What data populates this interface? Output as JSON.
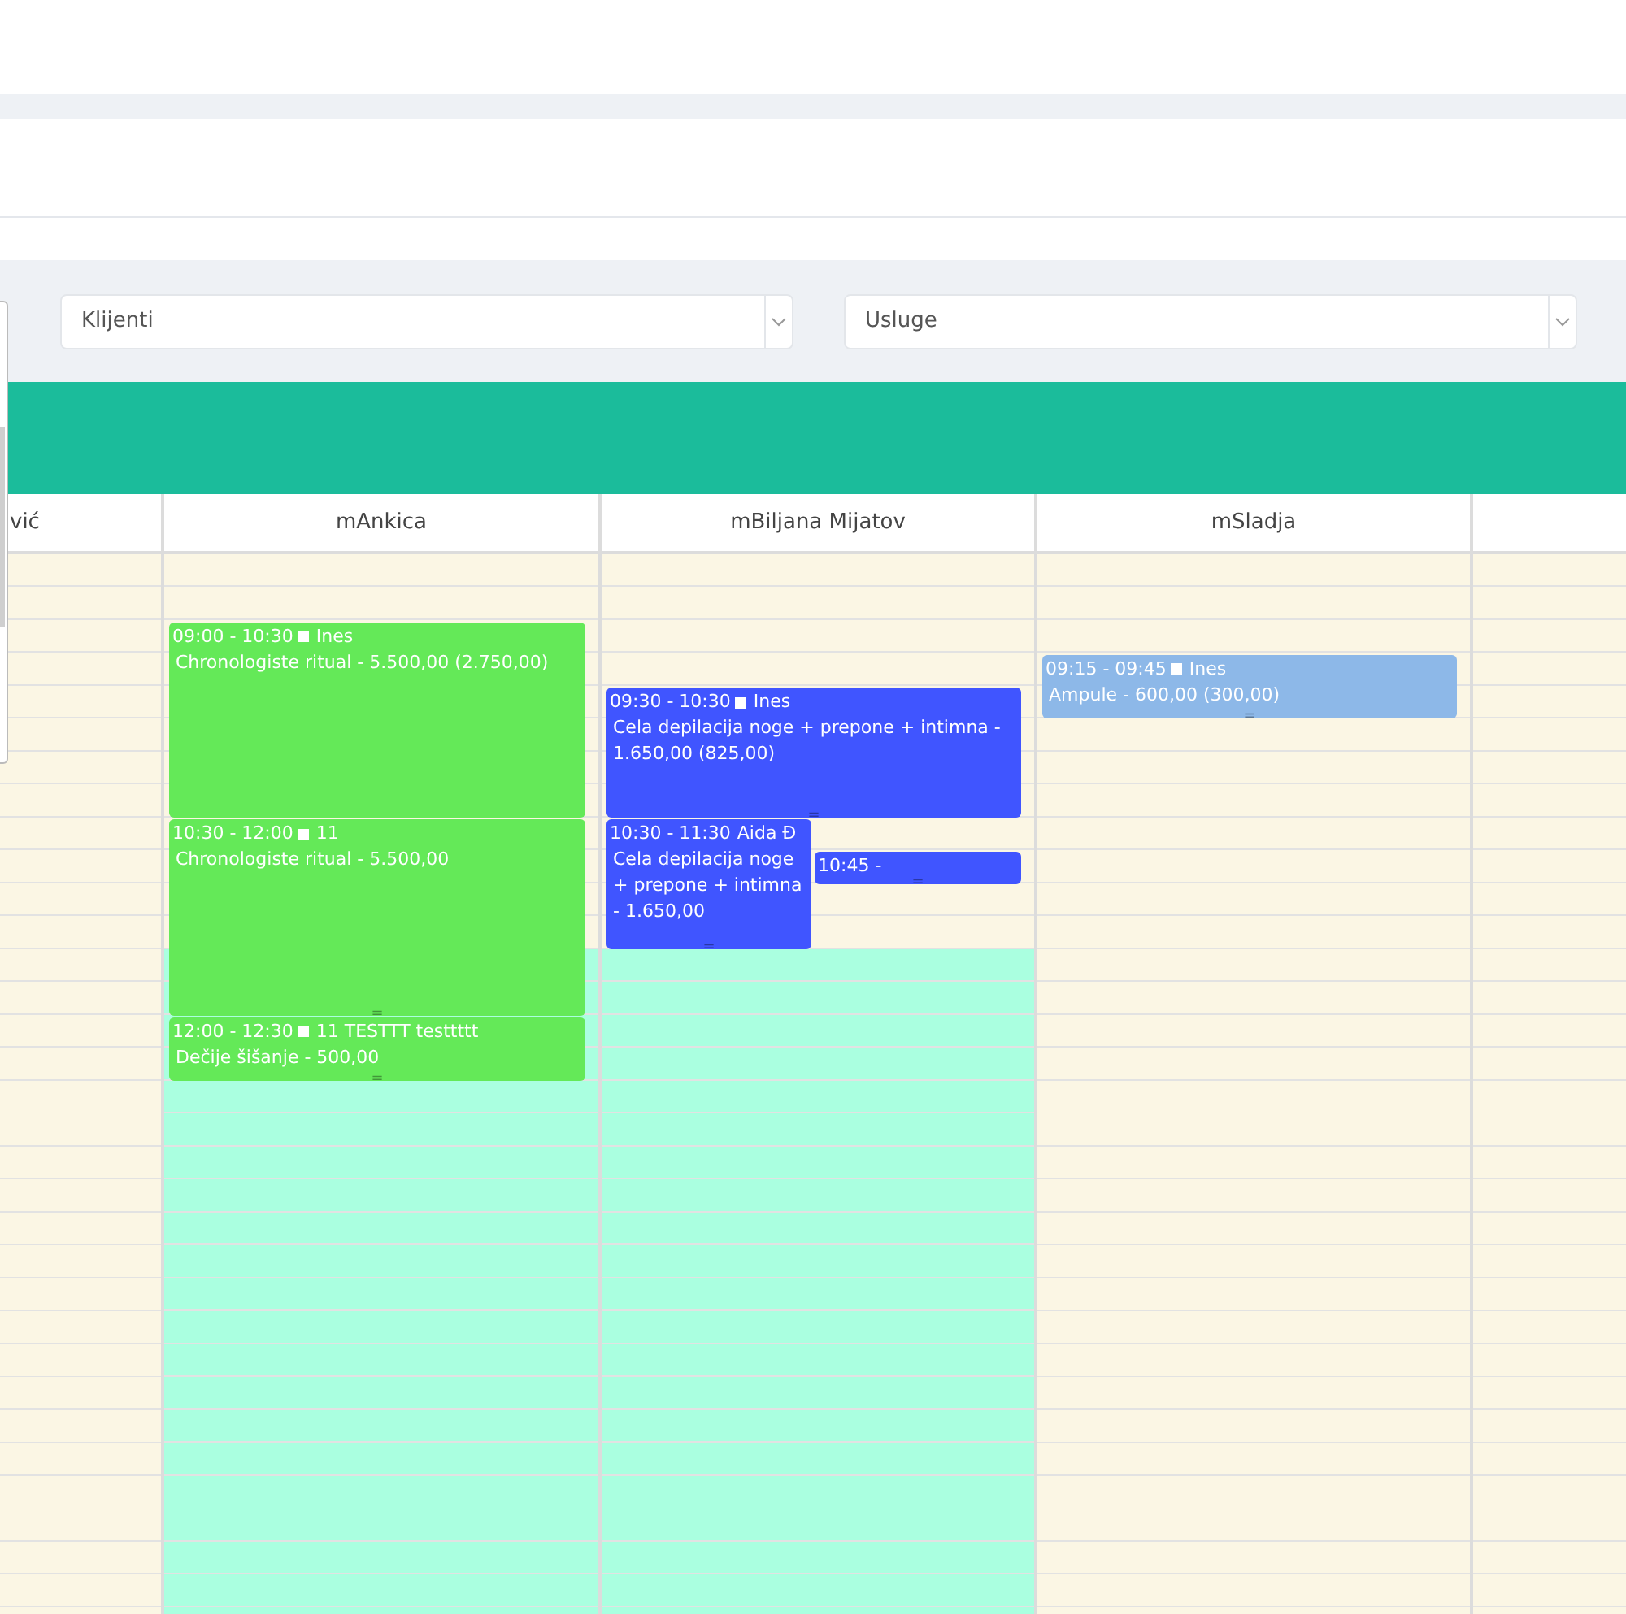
{
  "filters": [
    {
      "placeholder": "Klijenti"
    },
    {
      "placeholder": "Usluge"
    }
  ],
  "columns": [
    {
      "name": "vić",
      "shaded": false
    },
    {
      "name": "mAnkica",
      "shaded": true,
      "events": [
        {
          "kind": "full",
          "color": "#64e958",
          "time": "09:00 - 10:30",
          "marker": true,
          "client": "Ines",
          "service": "Chronologiste ritual - 5.500,00 (2.750,00)"
        },
        {
          "kind": "full",
          "color": "#64e958",
          "time": "10:30 - 12:00",
          "marker": true,
          "client": "11",
          "service": "Chronologiste ritual - 5.500,00",
          "handle": "="
        },
        {
          "kind": "full",
          "color": "#64e958",
          "time": "12:00 - 12:30",
          "marker": true,
          "client": "11 TESTTT testtttt",
          "service": "Dečije šišanje - 500,00",
          "handle": "="
        }
      ]
    },
    {
      "name": "mBiljana Mijatov",
      "shaded": true,
      "events": [
        {
          "kind": "full",
          "color": "#4055ff",
          "time": "09:30 - 10:30",
          "marker": true,
          "client": "Ines",
          "service": "Cela depilacija noge + prepone + intimna - 1.650,00 (825,00)",
          "handle": "="
        },
        {
          "kind": "left",
          "color": "#4055ff",
          "time": "10:30 - 11:30",
          "marker": false,
          "client": "Aida Đ",
          "service": "Cela depilacija noge + prepone + intimna - 1.650,00",
          "handle": "="
        },
        {
          "kind": "right",
          "color": "#4055ff",
          "time": "10:45 -",
          "marker": false,
          "handle": "="
        }
      ]
    },
    {
      "name": "mSladja",
      "shaded": false,
      "events": [
        {
          "kind": "full",
          "color": "#8db8e8",
          "time": "09:15 - 09:45",
          "marker": true,
          "client": "Ines",
          "service": "Ampule - 600,00 (300,00)",
          "handle": "="
        }
      ]
    },
    {
      "shaded": false
    }
  ]
}
